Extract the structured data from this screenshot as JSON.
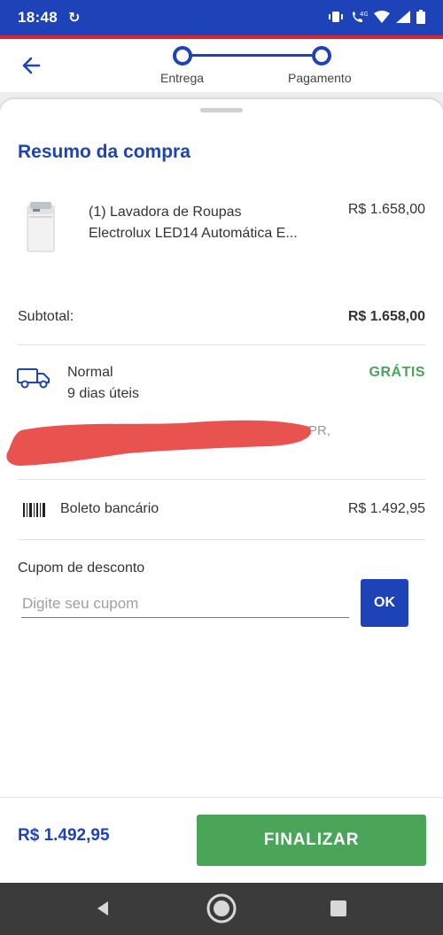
{
  "status_bar": {
    "time": "18:48",
    "notification_icon": "sync-icon",
    "icons": [
      "vibrate-icon",
      "wifi-call-4g-icon",
      "wifi-icon",
      "signal-icon",
      "battery-icon"
    ]
  },
  "stepper": {
    "steps": [
      {
        "label": "Entrega"
      },
      {
        "label": "Pagamento"
      }
    ]
  },
  "summary": {
    "title": "Resumo da compra",
    "product": {
      "line1": "(1) Lavadora de Roupas",
      "line2": "Electrolux LED14 Automática E...",
      "price": "R$ 1.658,00"
    },
    "subtotal": {
      "label": "Subtotal:",
      "value": "R$ 1.658,00"
    },
    "shipping": {
      "name": "Normal",
      "days": "9 dias úteis",
      "price": "GRÁTIS",
      "address_visible": "PR,"
    },
    "payment": {
      "method": "Boleto bancário",
      "value": "R$ 1.492,95"
    },
    "coupon": {
      "label": "Cupom de desconto",
      "placeholder": "Digite seu cupom",
      "value": "",
      "button": "OK"
    }
  },
  "footer": {
    "total": "R$ 1.492,95",
    "button": "FINALIZAR"
  },
  "colors": {
    "primary": "#1e43b8",
    "accent_red": "#d9262e",
    "success": "#4aa559",
    "redaction": "#e8524f"
  }
}
